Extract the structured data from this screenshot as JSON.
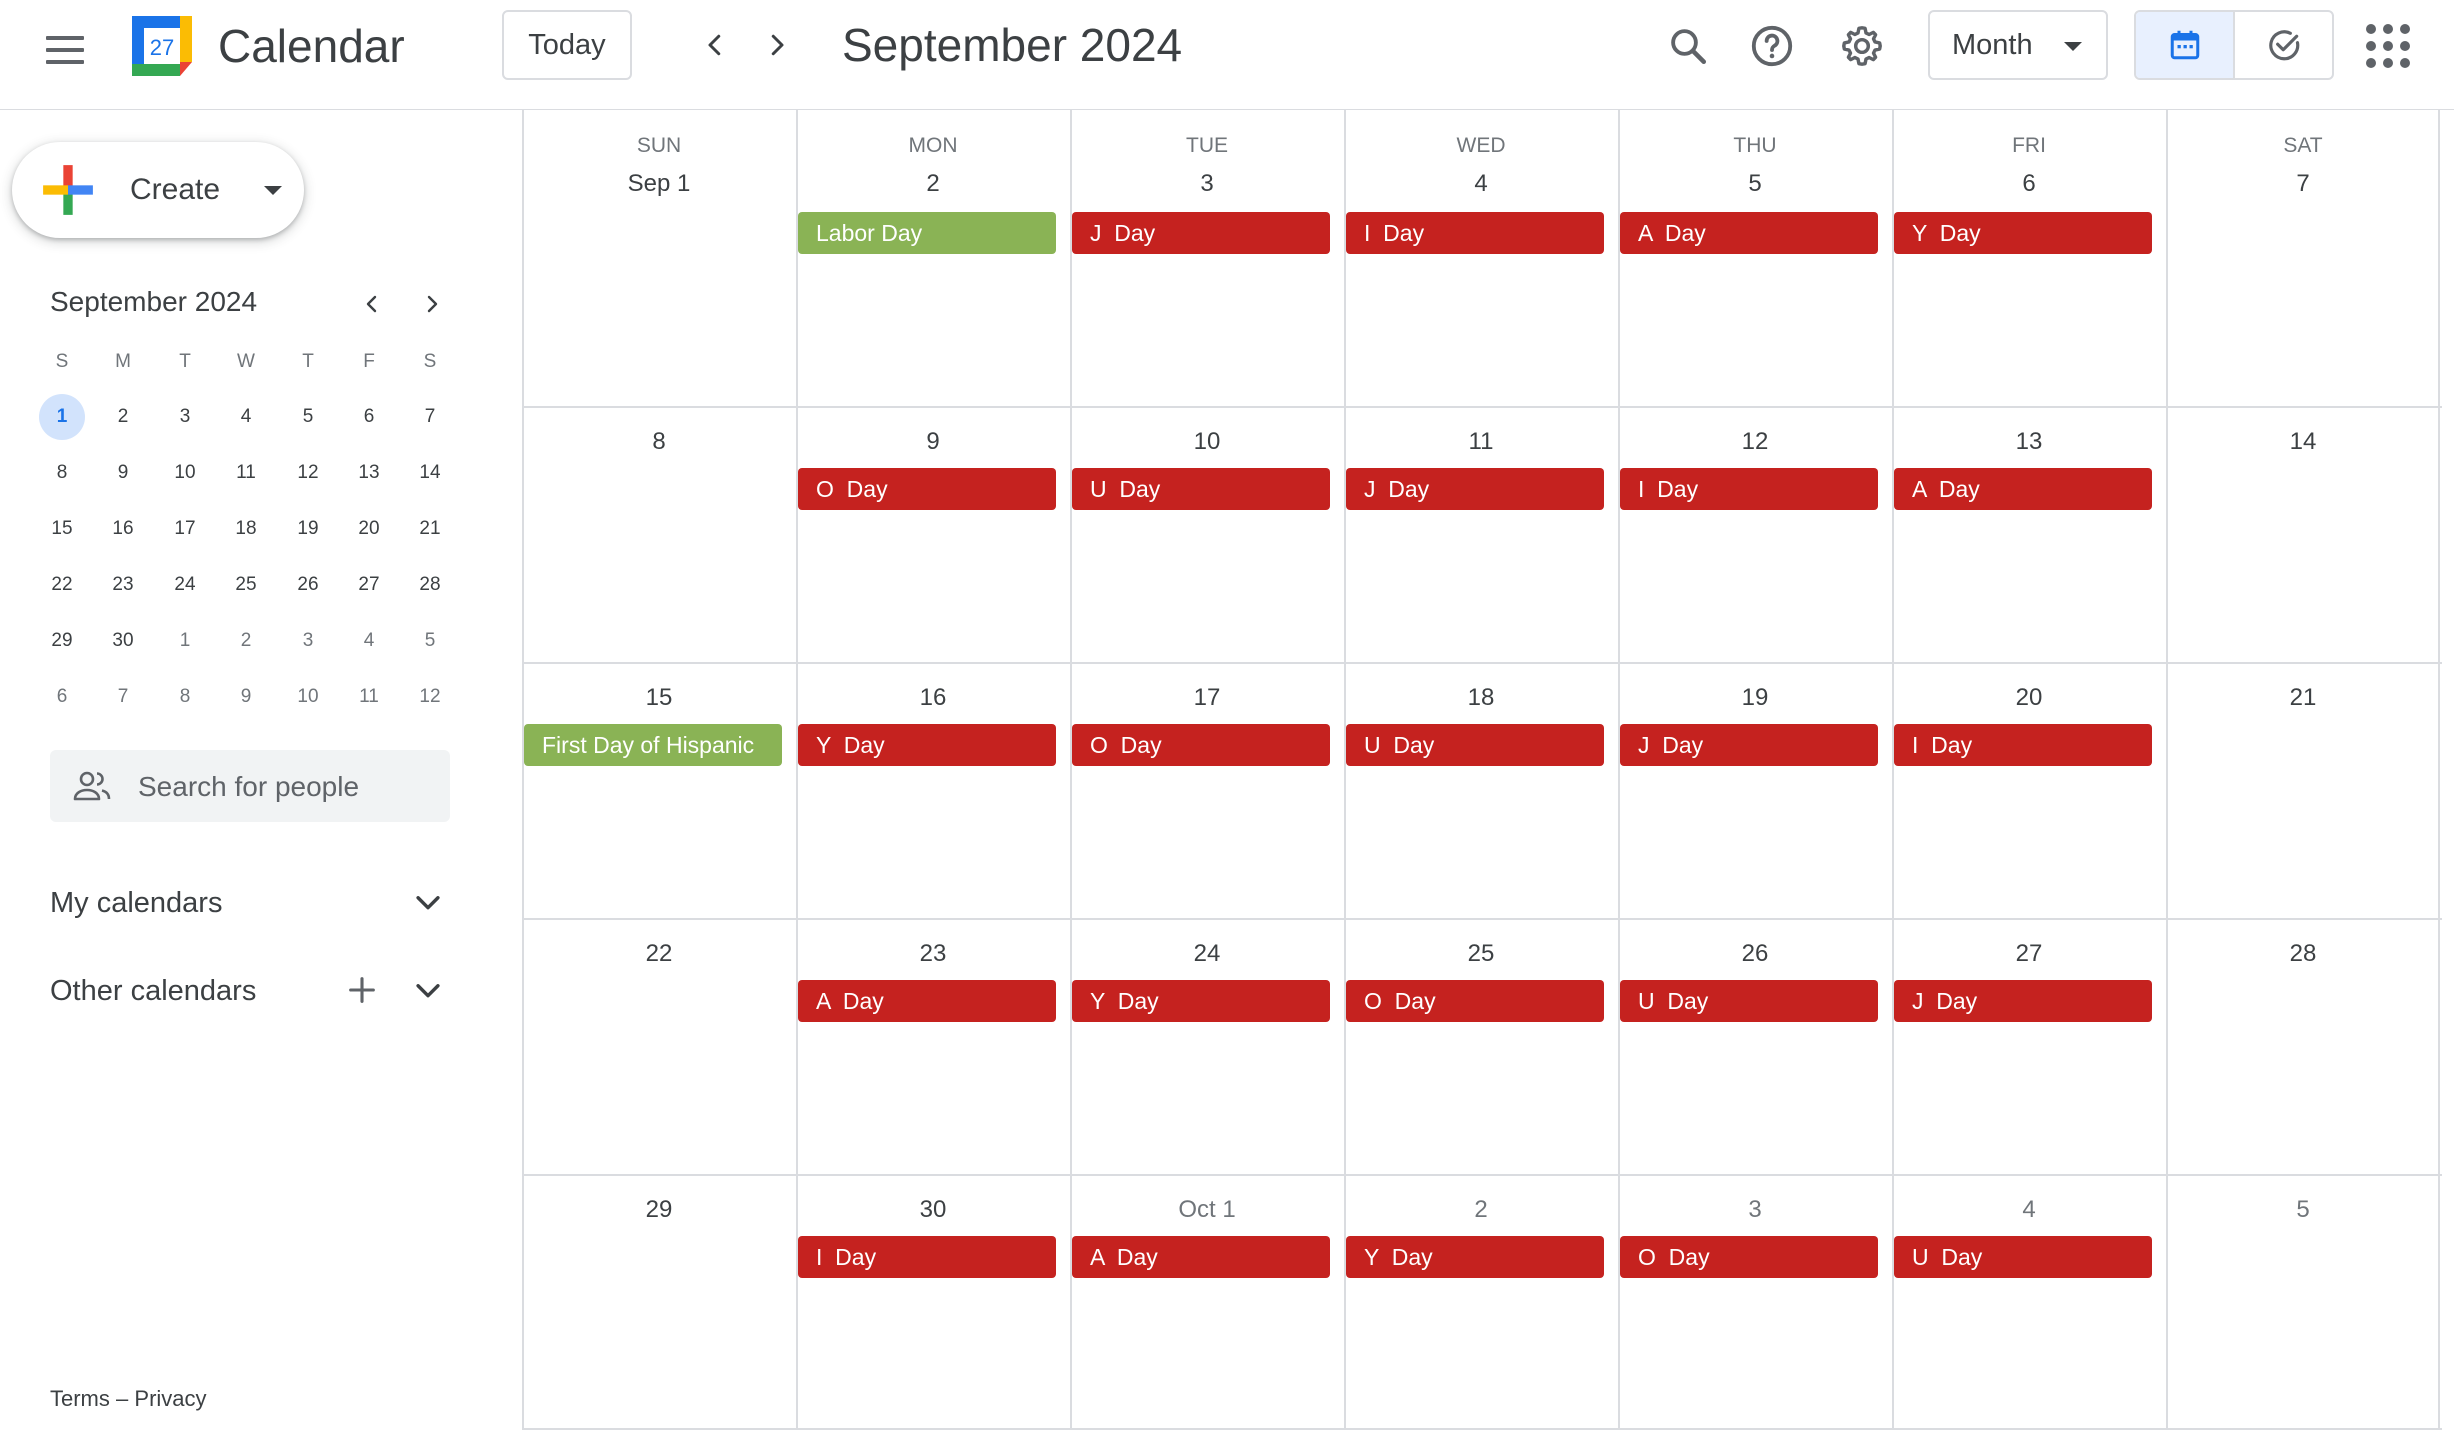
{
  "header": {
    "app_title": "Calendar",
    "logo_day": "27",
    "today_label": "Today",
    "period_title": "September 2024",
    "view_select_value": "Month"
  },
  "sidebar": {
    "create_label": "Create",
    "mini_calendar": {
      "title": "September 2024",
      "dow": [
        "S",
        "M",
        "T",
        "W",
        "T",
        "F",
        "S"
      ],
      "weeks": [
        [
          "1",
          "2",
          "3",
          "4",
          "5",
          "6",
          "7"
        ],
        [
          "8",
          "9",
          "10",
          "11",
          "12",
          "13",
          "14"
        ],
        [
          "15",
          "16",
          "17",
          "18",
          "19",
          "20",
          "21"
        ],
        [
          "22",
          "23",
          "24",
          "25",
          "26",
          "27",
          "28"
        ],
        [
          "29",
          "30",
          "1",
          "2",
          "3",
          "4",
          "5"
        ],
        [
          "6",
          "7",
          "8",
          "9",
          "10",
          "11",
          "12"
        ]
      ],
      "selected": "1"
    },
    "people_search_placeholder": "Search for people",
    "my_calendars_label": "My calendars",
    "other_calendars_label": "Other calendars",
    "footer": {
      "terms": "Terms",
      "separator": "–",
      "privacy": "Privacy"
    }
  },
  "month_grid": {
    "dow": [
      "SUN",
      "MON",
      "TUE",
      "WED",
      "THU",
      "FRI",
      "SAT"
    ],
    "weeks": [
      {
        "dates": [
          "Sep 1",
          "2",
          "3",
          "4",
          "5",
          "6",
          "7"
        ],
        "events": [
          {
            "day": 1,
            "title": "Labor Day",
            "type": "holiday"
          },
          {
            "day": 2,
            "title": "J  Day",
            "type": "event"
          },
          {
            "day": 3,
            "title": "I  Day",
            "type": "event"
          },
          {
            "day": 4,
            "title": "A  Day",
            "type": "event"
          },
          {
            "day": 5,
            "title": "Y  Day",
            "type": "event"
          }
        ]
      },
      {
        "dates": [
          "8",
          "9",
          "10",
          "11",
          "12",
          "13",
          "14"
        ],
        "events": [
          {
            "day": 1,
            "title": "O  Day",
            "type": "event"
          },
          {
            "day": 2,
            "title": "U  Day",
            "type": "event"
          },
          {
            "day": 3,
            "title": "J  Day",
            "type": "event"
          },
          {
            "day": 4,
            "title": "I  Day",
            "type": "event"
          },
          {
            "day": 5,
            "title": "A  Day",
            "type": "event"
          }
        ]
      },
      {
        "dates": [
          "15",
          "16",
          "17",
          "18",
          "19",
          "20",
          "21"
        ],
        "events": [
          {
            "day": 0,
            "title": "First Day of Hispanic",
            "type": "holiday"
          },
          {
            "day": 1,
            "title": "Y  Day",
            "type": "event"
          },
          {
            "day": 2,
            "title": "O  Day",
            "type": "event"
          },
          {
            "day": 3,
            "title": "U  Day",
            "type": "event"
          },
          {
            "day": 4,
            "title": "J  Day",
            "type": "event"
          },
          {
            "day": 5,
            "title": "I  Day",
            "type": "event"
          }
        ]
      },
      {
        "dates": [
          "22",
          "23",
          "24",
          "25",
          "26",
          "27",
          "28"
        ],
        "events": [
          {
            "day": 1,
            "title": "A  Day",
            "type": "event"
          },
          {
            "day": 2,
            "title": "Y  Day",
            "type": "event"
          },
          {
            "day": 3,
            "title": "O  Day",
            "type": "event"
          },
          {
            "day": 4,
            "title": "U  Day",
            "type": "event"
          },
          {
            "day": 5,
            "title": "J  Day",
            "type": "event"
          }
        ]
      },
      {
        "dates": [
          "29",
          "30",
          "Oct 1",
          "2",
          "3",
          "4",
          "5"
        ],
        "events": [
          {
            "day": 1,
            "title": "I  Day",
            "type": "event"
          },
          {
            "day": 2,
            "title": "A  Day",
            "type": "event"
          },
          {
            "day": 3,
            "title": "Y  Day",
            "type": "event"
          },
          {
            "day": 4,
            "title": "O  Day",
            "type": "event"
          },
          {
            "day": 5,
            "title": "U  Day",
            "type": "event"
          }
        ]
      }
    ]
  },
  "colors": {
    "event": "#c5221f",
    "holiday": "#8ab355",
    "accent_blue": "#1a73e8",
    "selected_bg": "#d2e3fc"
  },
  "icons": {
    "menu": "hamburger-menu-icon",
    "search": "search-icon",
    "help": "help-icon",
    "settings": "gear-icon",
    "calendar_view": "calendar-icon",
    "tasks_view": "check-circle-icon",
    "apps": "apps-grid-icon"
  }
}
